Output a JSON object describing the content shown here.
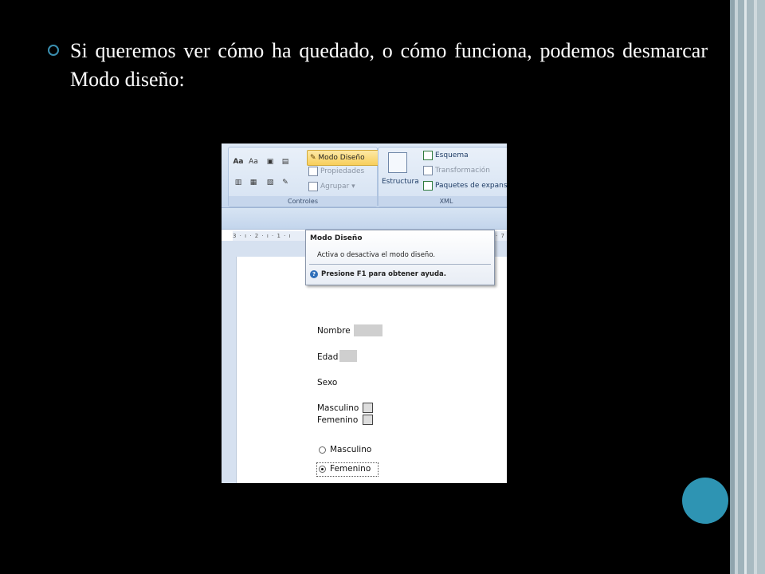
{
  "slide": {
    "bullet_text": "Si queremos ver cómo ha quedado, o cómo funciona, podemos desmarcar Modo diseño:",
    "colors": {
      "background": "#000000",
      "accent": "#2e94b3"
    }
  },
  "ribbon": {
    "controles": {
      "label": "Controles",
      "modo_diseno": "Modo Diseño",
      "propiedades": "Propiedades",
      "agrupar": "Agrupar",
      "icon_aa_1": "Aa",
      "icon_aa_2": "Aa"
    },
    "xml": {
      "label": "XML",
      "estructura": "Estructura",
      "esquema": "Esquema",
      "transformacion": "Transformación",
      "paquetes": "Paquetes de expans"
    }
  },
  "ruler": {
    "text": "3 · ı · 2 · ı · 1 · ı",
    "right_text": "· 7"
  },
  "tooltip": {
    "title": "Modo Diseño",
    "description": "Activa o desactiva el modo diseño.",
    "help": "Presione F1 para obtener ayuda.",
    "help_icon": "?"
  },
  "form": {
    "nombre": "Nombre",
    "edad": "Edad",
    "sexo": "Sexo",
    "check_masculino": "Masculino",
    "check_femenino": "Femenino",
    "radio_masculino": "Masculino",
    "radio_femenino": "Femenino",
    "selected_radio": "Femenino"
  }
}
